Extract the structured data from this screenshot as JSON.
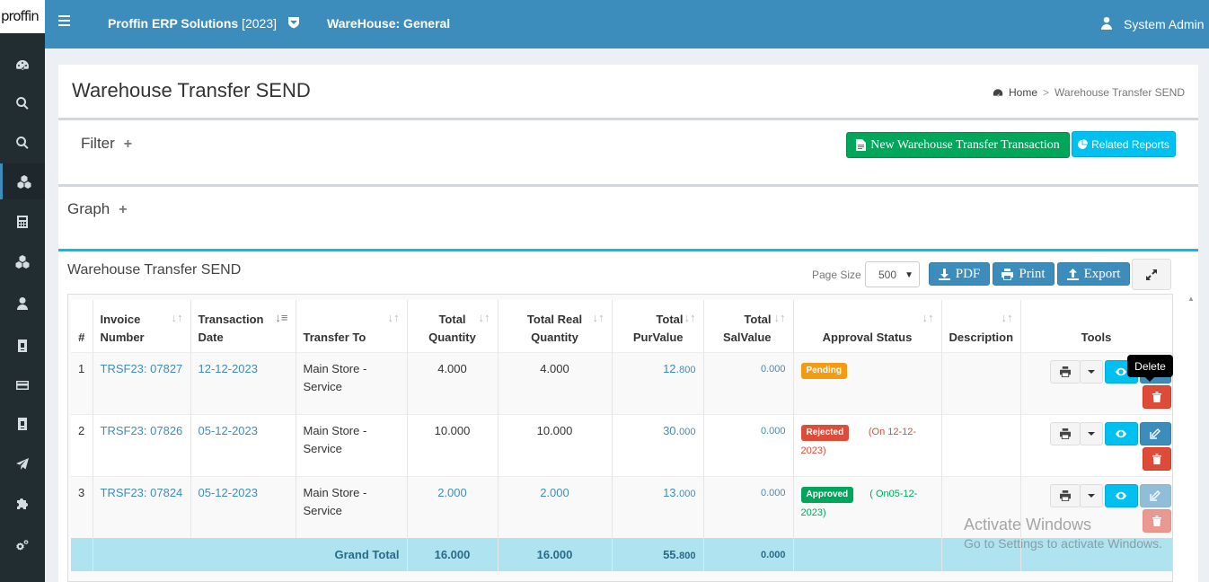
{
  "logo_text": "proffin",
  "header": {
    "company": "Proffin ERP Solutions",
    "year": "[2023]",
    "warehouse": "WareHouse: General",
    "user": "System Admin"
  },
  "sidebar": {
    "items": [
      {
        "icon": "dashboard-icon"
      },
      {
        "icon": "search-icon"
      },
      {
        "icon": "search-icon"
      },
      {
        "icon": "cubes-icon",
        "active": true
      },
      {
        "icon": "calculator-icon"
      },
      {
        "icon": "cubes-icon"
      },
      {
        "icon": "user-icon"
      },
      {
        "icon": "id-card-icon"
      },
      {
        "icon": "credit-card-icon"
      },
      {
        "icon": "id-card-icon"
      },
      {
        "icon": "plane-icon"
      },
      {
        "icon": "puzzle-icon"
      },
      {
        "icon": "cogs-icon"
      }
    ]
  },
  "page": {
    "title": "Warehouse Transfer SEND",
    "breadcrumb_home": "Home",
    "breadcrumb_sep": ">",
    "breadcrumb_current": "Warehouse Transfer SEND"
  },
  "filter": {
    "label": "Filter",
    "plus": "+",
    "new_button": "New Warehouse Transfer Transaction",
    "related_button": "Related Reports"
  },
  "graph": {
    "label": "Graph",
    "plus": "+"
  },
  "list": {
    "title": "Warehouse Transfer SEND",
    "page_size_label": "Page Size",
    "page_size_value": "500",
    "pdf_label": "PDF",
    "print_label": "Print",
    "export_label": "Export"
  },
  "table": {
    "headers": [
      "#",
      "Invoice Number",
      "Transaction Date",
      "Transfer To",
      "Total Quantity",
      "Total Real Quantity",
      "Total PurValue",
      "Total SalValue",
      "Approval Status",
      "Description",
      "Tools"
    ],
    "rows": [
      {
        "num": "1",
        "invoice": "TRSF23: 07827",
        "date": "12-12-2023",
        "transfer_to": "Main Store - Service",
        "qty": "4.000",
        "real_qty": "4.000",
        "pur_int": "12.",
        "pur_dec": "800",
        "sal": "0.000",
        "status": "Pending",
        "note": "",
        "description": ""
      },
      {
        "num": "2",
        "invoice": "TRSF23: 07826",
        "date": "05-12-2023",
        "transfer_to": "Main Store - Service",
        "qty": "10.000",
        "real_qty": "10.000",
        "pur_int": "30.",
        "pur_dec": "000",
        "sal": "0.000",
        "status": "Rejected",
        "note": "(On 12-12-2023)",
        "description": ""
      },
      {
        "num": "3",
        "invoice": "TRSF23: 07824",
        "date": "05-12-2023",
        "transfer_to": "Main Store - Service",
        "qty": "2.000",
        "real_qty": "2.000",
        "pur_int": "13.",
        "pur_dec": "000",
        "sal": "0.000",
        "status": "Approved",
        "note": "( On05-12-2023)",
        "description": ""
      }
    ],
    "total": {
      "label": "Grand Total",
      "qty": "16.000",
      "real_qty": "16.000",
      "pur_int": "55.",
      "pur_dec": "800",
      "sal": "0.000"
    }
  },
  "tooltip": "Delete",
  "watermark": {
    "line1": "Activate Windows",
    "line2": "Go to Settings to activate Windows."
  },
  "colors": {
    "header": "#3c8dbc",
    "sidebar": "#222d32",
    "success": "#00a65a",
    "info": "#00c0ef",
    "danger": "#dd4b39",
    "warning": "#f39c12"
  }
}
